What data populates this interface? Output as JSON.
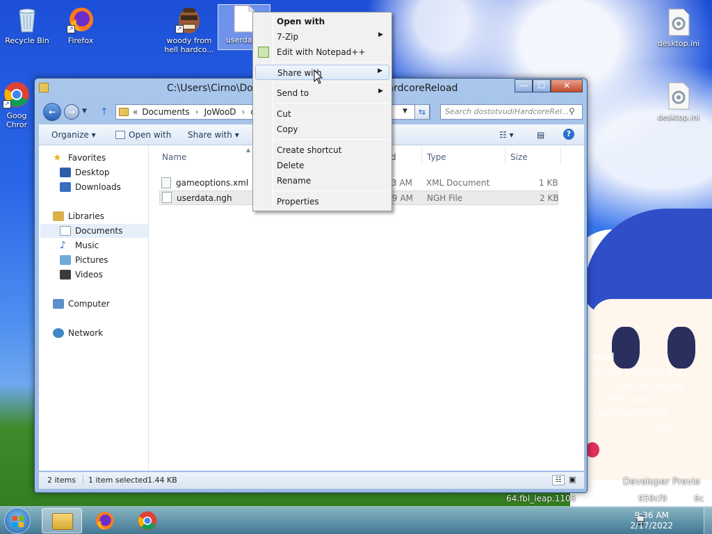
{
  "desktop": {
    "icons": [
      {
        "label": "Recycle Bin",
        "icon": "recycle-bin-icon"
      },
      {
        "label": "Firefox",
        "icon": "firefox-icon"
      },
      {
        "label": "woody from hell hardco...",
        "icon": "woody-shortcut-icon"
      },
      {
        "label": "userdata.",
        "icon": "file-icon"
      },
      {
        "label": "Goog Chror",
        "icon": "chrome-icon"
      },
      {
        "label": "desktop.ini",
        "icon": "ini-file-icon"
      },
      {
        "label": "desktop.ini",
        "icon": "ini-file-icon"
      }
    ],
    "watermark_lines": [
      "ntial",
      "in any manner may",
      "and including",
      "in the case of",
      "assignment or",
      "and"
    ],
    "build_lines": [
      "Developer Previe",
      "64.fbl_leap.1108",
      "959cf9",
      "6c"
    ]
  },
  "window": {
    "title": "C:\\Users\\Cirno\\Doc",
    "title_tail": "ardcoreReload",
    "buttons": {
      "minimize": "—",
      "maximize": "☐",
      "close": "✕"
    },
    "breadcrumb": [
      "«",
      "Documents",
      "JoWooD",
      "d"
    ],
    "search_placeholder": "Search dostotvudiHardcoreRel...",
    "toolbar": {
      "organize": "Organize",
      "open_with": "Open with",
      "share_with": "Share with"
    },
    "nav": {
      "favorites": "Favorites",
      "desktop": "Desktop",
      "downloads": "Downloads",
      "libraries": "Libraries",
      "documents": "Documents",
      "music": "Music",
      "pictures": "Pictures",
      "videos": "Videos",
      "computer": "Computer",
      "network": "Network"
    },
    "columns": {
      "name": "Name",
      "date": "d",
      "type": "Type",
      "size": "Size"
    },
    "files": [
      {
        "name": "gameoptions.xml",
        "date": "3 AM",
        "type": "XML Document",
        "size": "1 KB"
      },
      {
        "name": "userdata.ngh",
        "date": "9 AM",
        "type": "NGH File",
        "size": "2 KB"
      }
    ],
    "status": {
      "items": "2 items",
      "selected": "1 item selected",
      "size": "1.44 KB"
    }
  },
  "context_menu": {
    "items": [
      {
        "label": "Open with",
        "bold": true,
        "submenu": false
      },
      {
        "label": "7-Zip",
        "submenu": true
      },
      {
        "label": "Edit with Notepad++",
        "submenu": false
      },
      {
        "label": "Share with",
        "submenu": true,
        "highlighted": true
      },
      {
        "label": "Send to",
        "submenu": true
      },
      {
        "label": "Cut",
        "submenu": false
      },
      {
        "label": "Copy",
        "submenu": false
      },
      {
        "label": "Create shortcut",
        "submenu": false
      },
      {
        "label": "Delete",
        "submenu": false
      },
      {
        "label": "Rename",
        "submenu": false
      },
      {
        "label": "Properties",
        "submenu": false
      }
    ],
    "submenu_arrow": "▶"
  },
  "taskbar": {
    "time": "9:36 AM",
    "date": "2/17/2022"
  },
  "colors": {
    "accent": "#1e395b",
    "selection": "#e5eef9",
    "menu_highlight": "#dde9f8"
  }
}
